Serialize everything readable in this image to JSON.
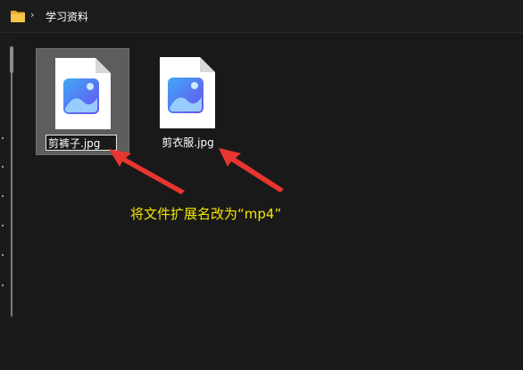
{
  "address_bar": {
    "folder_icon": "folder-icon",
    "separator": "›",
    "path": "学习资料"
  },
  "files": [
    {
      "name": "剪裤子.jpg",
      "icon": "image-file-icon",
      "selected": true,
      "renaming": true
    },
    {
      "name": "剪衣服.jpg",
      "icon": "image-file-icon",
      "selected": false,
      "renaming": false
    }
  ],
  "annotation": {
    "text": "将文件扩展名改为“mp4”",
    "color": "#f5e600",
    "arrow_color": "#e8352f"
  },
  "colors": {
    "background": "#191919",
    "selection": "#5d5d5d",
    "folder": "#f2c14e",
    "image_gradient_start": "#3a7be8",
    "image_gradient_end": "#7b5cf0"
  }
}
